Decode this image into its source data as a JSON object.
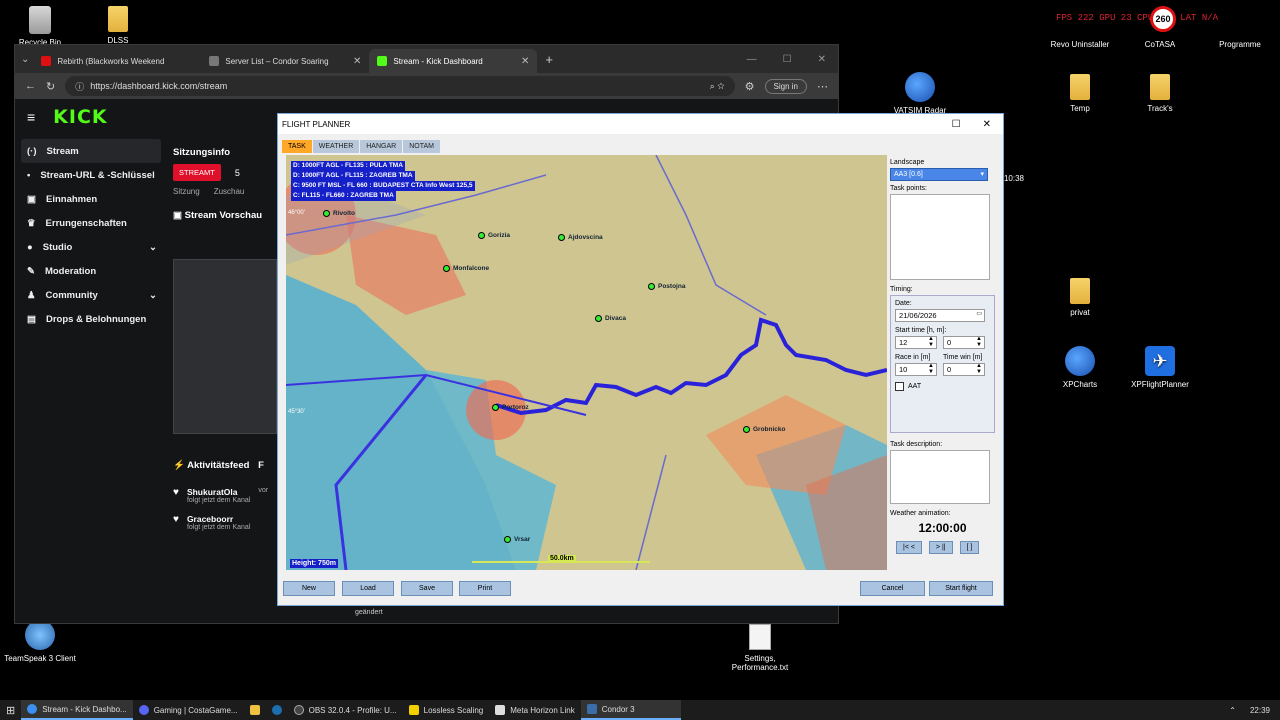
{
  "desktop": {
    "icons": [
      {
        "label": "Recycle Bin",
        "icon": "recycle-bin-icon"
      },
      {
        "label": "DLSS",
        "icon": "folder-icon"
      },
      {
        "label": "Revo Uninstaller",
        "icon": "revo-icon"
      },
      {
        "label": "CoTASA",
        "icon": "folder-icon"
      },
      {
        "label": "Programme",
        "icon": "folder-icon"
      },
      {
        "label": "VATSIM Radar",
        "icon": "vatsim-icon"
      },
      {
        "label": "Temp",
        "icon": "folder-icon"
      },
      {
        "label": "Track's",
        "icon": "folder-icon"
      },
      {
        "label": "privat",
        "icon": "folder-icon"
      },
      {
        "label": "XPCharts",
        "icon": "globe-icon"
      },
      {
        "label": "XPFlightPlanner",
        "icon": "plane-icon"
      },
      {
        "label": "TeamSpeak 3 Client",
        "icon": "teamspeak-icon"
      },
      {
        "label": "Settings, Performance.txt",
        "icon": "text-file-icon"
      }
    ],
    "overlay_text": "FPS 222   GPU 23   CPU 12%   LAT N/A",
    "overlay_badge": "260",
    "side_time": "10:38"
  },
  "browser": {
    "tabs": [
      {
        "label": "Rebirth (Blackworks Weekend",
        "color": "#e01010"
      },
      {
        "label": "Server List – Condor Soaring",
        "color": "#777777"
      },
      {
        "label": "Stream - Kick Dashboard",
        "color": "#53fc18"
      }
    ],
    "url": "https://dashboard.kick.com/stream",
    "signin": "Sign in"
  },
  "kick": {
    "logo": "KICK",
    "nav": [
      {
        "label": "Stream",
        "icon": "stream-icon"
      },
      {
        "label": "Stream-URL & -Schlüssel",
        "icon": "key-icon"
      },
      {
        "label": "Einnahmen",
        "icon": "wallet-icon"
      },
      {
        "label": "Errungenschaften",
        "icon": "trophy-icon"
      },
      {
        "label": "Studio",
        "icon": "studio-icon"
      },
      {
        "label": "Moderation",
        "icon": "wrench-icon"
      },
      {
        "label": "Community",
        "icon": "community-icon"
      },
      {
        "label": "Drops & Belohnungen",
        "icon": "gift-icon"
      }
    ],
    "session_title": "Sitzungsinfo",
    "live_badge": "STREAMT",
    "viewers": "5",
    "session_label": "Sitzung",
    "viewers_label": "Zuschau",
    "preview_title": "Stream Vorschau",
    "feed_title": "Aktivitätsfeed",
    "feed_tab": "F",
    "feed": [
      {
        "name": "ShukuratOla",
        "sub": "folgt jetzt dem Kanal",
        "time": "vor"
      },
      {
        "name": "Graceboorr",
        "sub": "folgt jetzt dem Kanal",
        "time": ""
      }
    ],
    "changed": "geändert"
  },
  "planner": {
    "title": "FLIGHT PLANNER",
    "tabs": [
      "TASK",
      "WEATHER",
      "HANGAR",
      "NOTAM"
    ],
    "notes": [
      "D: 1000FT AGL - FL135 : PULA TMA",
      "D: 1000FT AGL - FL115 : ZAGREB TMA",
      "C: 9500 FT MSL - FL 660 : BUDAPEST CTA Info West 125,5",
      "C: FL115 - FL660 : ZAGREB TMA"
    ],
    "points": [
      "Gorizia",
      "Ajdovscina",
      "Monfalcone",
      "Postojna",
      "Divaca",
      "Portoroz",
      "Grobnicko",
      "Vrsar",
      "Rivolto"
    ],
    "coord_n": "46°00'",
    "coord_s": "45°30'",
    "height": "Height: 750m",
    "scale": "50.0km",
    "landscape_label": "Landscape",
    "landscape_value": "AA3 [0.6]",
    "task_points_label": "Task points:",
    "timing_label": "Timing:",
    "date_label": "Date:",
    "date_value": "21/06/2026",
    "start_label": "Start time [h, m]:",
    "start_h": "12",
    "start_m": "0",
    "race_label": "Race in [m]",
    "race_value": "10",
    "timewin_label": "Time win [m]",
    "timewin_value": "0",
    "aat_label": "AAT",
    "desc_label": "Task description:",
    "weather_label": "Weather animation:",
    "weather_time": "12:00:00",
    "play": [
      "|< <",
      "> ||",
      "[ ]"
    ],
    "buttons": {
      "new": "New",
      "load": "Load",
      "save": "Save",
      "print": "Print",
      "cancel": "Cancel",
      "start": "Start flight"
    }
  },
  "taskbar": {
    "items": [
      {
        "label": "Stream - Kick Dashbo...",
        "color": "#3a8ff0"
      },
      {
        "label": "Gaming | CostaGame...",
        "color": "#5865f2"
      },
      {
        "label": "",
        "color": "#f0c040"
      },
      {
        "label": "",
        "color": "#1b6fb0"
      },
      {
        "label": "OBS 32.0.4 - Profile: U...",
        "color": "#444444"
      },
      {
        "label": "Lossless Scaling",
        "color": "#f5d000"
      },
      {
        "label": "Meta Horizon Link",
        "color": "#dddddd"
      },
      {
        "label": "Condor 3",
        "color": "#3a6ea8"
      }
    ],
    "time": "22:39"
  }
}
